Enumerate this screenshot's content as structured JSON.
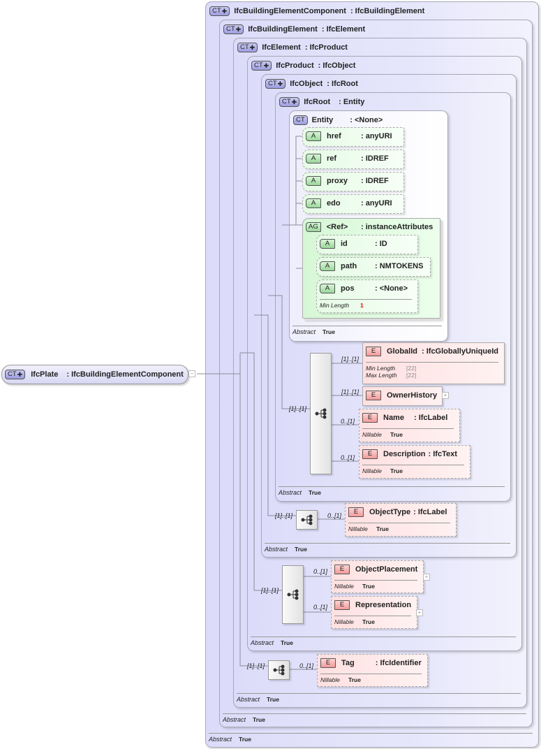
{
  "root": {
    "badge": "CT",
    "name": "IfcPlate",
    "type": ": IfcBuildingElementComponent",
    "collapse": "−"
  },
  "containers": [
    {
      "badge": "CT",
      "name": "IfcBuildingElementComponent",
      "type": ": IfcBuildingElement",
      "footer_label": "Abstract",
      "footer_value": "True"
    },
    {
      "badge": "CT",
      "name": "IfcBuildingElement",
      "type": ": IfcElement",
      "footer_label": "Abstract",
      "footer_value": "True"
    },
    {
      "badge": "CT",
      "name": "IfcElement",
      "type": ": IfcProduct",
      "footer_label": "Abstract",
      "footer_value": "True"
    },
    {
      "badge": "CT",
      "name": "IfcProduct",
      "type": ": IfcObject",
      "footer_label": "Abstract",
      "footer_value": "True"
    },
    {
      "badge": "CT",
      "name": "IfcObject",
      "type": ": IfcRoot",
      "footer_label": "Abstract",
      "footer_value": "True"
    },
    {
      "badge": "CT",
      "name": "IfcRoot",
      "type": ": Entity",
      "footer_label": "Abstract",
      "footer_value": "True"
    },
    {
      "badge": "CT",
      "name": "Entity",
      "type": ": <None>",
      "footer_label": "Abstract",
      "footer_value": "True"
    }
  ],
  "attributes": [
    {
      "badge": "A",
      "name": "href",
      "type": ": anyURI"
    },
    {
      "badge": "A",
      "name": "ref",
      "type": ": IDREF"
    },
    {
      "badge": "A",
      "name": "proxy",
      "type": ": IDREF"
    },
    {
      "badge": "A",
      "name": "edo",
      "type": ": anyURI"
    }
  ],
  "attribute_group": {
    "badge": "AG",
    "name": "<Ref>",
    "type": ": instanceAttributes",
    "attributes": [
      {
        "badge": "A",
        "name": "id",
        "type": ": ID"
      },
      {
        "badge": "A",
        "name": "path",
        "type": ": NMTOKENS"
      },
      {
        "badge": "A",
        "name": "pos",
        "type": ": <None>",
        "facet_label": "Min Length",
        "facet_value": "1"
      }
    ]
  },
  "elements": [
    {
      "badge": "E",
      "name": "GlobalId",
      "type": ": IfcGloballyUniqueId",
      "cardinality": "[1]..[1]",
      "facets": [
        {
          "label": "Min Length",
          "value": "[22]"
        },
        {
          "label": "Max Length",
          "value": "[22]"
        }
      ]
    },
    {
      "badge": "E",
      "name": "OwnerHistory",
      "type": "",
      "cardinality": "[1]..[1]",
      "expand": "+"
    },
    {
      "badge": "E",
      "name": "Name",
      "type": ": IfcLabel",
      "cardinality": "0..[1]",
      "facets": [
        {
          "label": "Nillable",
          "value": "True"
        }
      ]
    },
    {
      "badge": "E",
      "name": "Description",
      "type": ": IfcText",
      "cardinality": "0..[1]",
      "facets": [
        {
          "label": "Nillable",
          "value": "True"
        }
      ]
    },
    {
      "badge": "E",
      "name": "ObjectType",
      "type": ": IfcLabel",
      "cardinality": "0..[1]",
      "facets": [
        {
          "label": "Nillable",
          "value": "True"
        }
      ]
    },
    {
      "badge": "E",
      "name": "ObjectPlacement",
      "type": "",
      "cardinality": "0..[1]",
      "expand": "+",
      "facets": [
        {
          "label": "Nillable",
          "value": "True"
        }
      ]
    },
    {
      "badge": "E",
      "name": "Representation",
      "type": "",
      "cardinality": "0..[1]",
      "expand": "+",
      "facets": [
        {
          "label": "Nillable",
          "value": "True"
        }
      ]
    },
    {
      "badge": "E",
      "name": "Tag",
      "type": ": IfcIdentifier",
      "cardinality": "0..[1]",
      "facets": [
        {
          "label": "Nillable",
          "value": "True"
        }
      ]
    }
  ],
  "sequences": [
    {
      "owner": "IfcRoot",
      "cardinality": "[1]..[1]",
      "icon": "sequence-icon"
    },
    {
      "owner": "IfcObject",
      "cardinality": "[1]..[1]",
      "icon": "sequence-icon"
    },
    {
      "owner": "IfcProduct",
      "cardinality": "[1]..[1]",
      "icon": "sequence-icon"
    },
    {
      "owner": "IfcElement",
      "cardinality": "[1]..[1]",
      "icon": "sequence-icon"
    }
  ],
  "colors": {
    "complex_type": "#dcdcfa",
    "attribute": "#e6fbe6",
    "element": "#ffe0e0",
    "facet_value_red": "#e00000"
  }
}
